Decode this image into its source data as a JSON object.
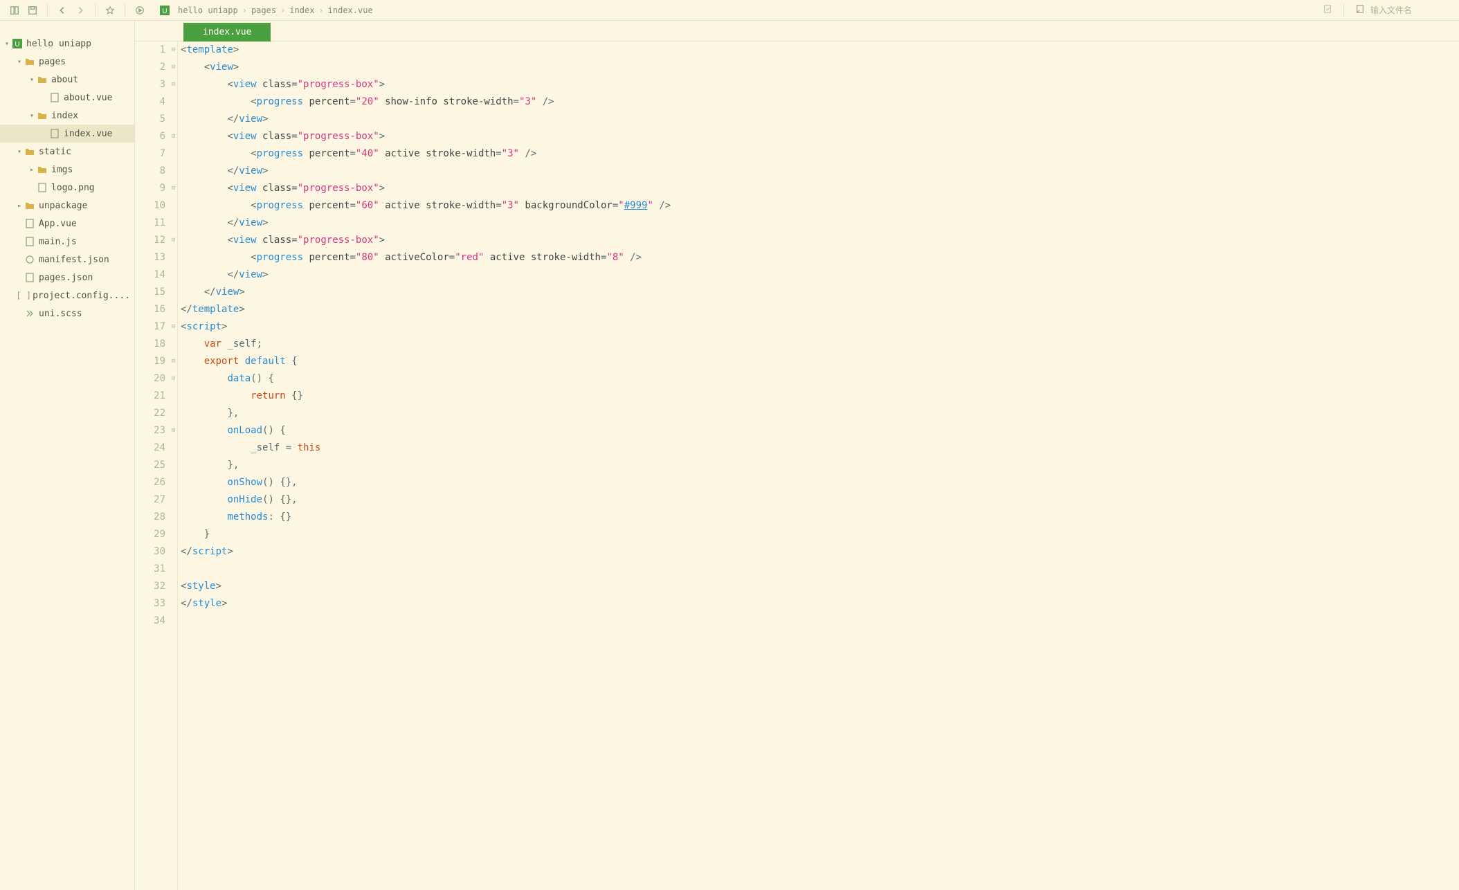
{
  "toolbar": {
    "search_placeholder": "输入文件名"
  },
  "breadcrumb": {
    "parts": [
      "hello uniapp",
      "pages",
      "index",
      "index.vue"
    ]
  },
  "tree": [
    {
      "depth": 0,
      "arrow": "▾",
      "type": "project",
      "label": "hello uniapp"
    },
    {
      "depth": 1,
      "arrow": "▾",
      "type": "folder",
      "label": "pages"
    },
    {
      "depth": 2,
      "arrow": "▾",
      "type": "folder",
      "label": "about"
    },
    {
      "depth": 3,
      "arrow": "",
      "type": "file",
      "label": "about.vue"
    },
    {
      "depth": 2,
      "arrow": "▾",
      "type": "folder",
      "label": "index",
      "selected_folder": false
    },
    {
      "depth": 3,
      "arrow": "",
      "type": "file",
      "label": "index.vue",
      "selected": true
    },
    {
      "depth": 1,
      "arrow": "▾",
      "type": "folder",
      "label": "static"
    },
    {
      "depth": 2,
      "arrow": "▸",
      "type": "folder",
      "label": "imgs"
    },
    {
      "depth": 2,
      "arrow": "",
      "type": "image",
      "label": "logo.png"
    },
    {
      "depth": 1,
      "arrow": "▸",
      "type": "folder",
      "label": "unpackage"
    },
    {
      "depth": 1,
      "arrow": "",
      "type": "file",
      "label": "App.vue"
    },
    {
      "depth": 1,
      "arrow": "",
      "type": "file",
      "label": "main.js"
    },
    {
      "depth": 1,
      "arrow": "",
      "type": "json",
      "label": "manifest.json"
    },
    {
      "depth": 1,
      "arrow": "",
      "type": "file",
      "label": "pages.json"
    },
    {
      "depth": 1,
      "arrow": "",
      "type": "bracket",
      "label": "project.config...."
    },
    {
      "depth": 1,
      "arrow": "",
      "type": "scss",
      "label": "uni.scss"
    }
  ],
  "tabs": {
    "active": "index.vue"
  },
  "editor": {
    "line_count": 34,
    "foldable_lines": [
      1,
      2,
      3,
      6,
      9,
      12,
      17,
      19,
      20,
      23
    ],
    "code": {
      "l1": {
        "tag": "template"
      },
      "l2": {
        "tag": "view"
      },
      "l3": {
        "tag": "view",
        "attr": "class",
        "val": "\"progress-box\""
      },
      "l4": {
        "tag": "progress",
        "a1": "percent",
        "v1": "\"20\"",
        "a2": "show-info",
        "a3": "stroke-width",
        "v3": "\"3\""
      },
      "l5": {
        "tag": "view"
      },
      "l6": {
        "tag": "view",
        "attr": "class",
        "val": "\"progress-box\""
      },
      "l7": {
        "tag": "progress",
        "a1": "percent",
        "v1": "\"40\"",
        "a2": "active",
        "a3": "stroke-width",
        "v3": "\"3\""
      },
      "l8": {
        "tag": "view"
      },
      "l9": {
        "tag": "view",
        "attr": "class",
        "val": "\"progress-box\""
      },
      "l10": {
        "tag": "progress",
        "a1": "percent",
        "v1": "\"60\"",
        "a2": "active",
        "a3": "stroke-width",
        "v3": "\"3\"",
        "a4": "backgroundColor",
        "v4": "\"",
        "v4link": "#999",
        "v4end": "\""
      },
      "l11": {
        "tag": "view"
      },
      "l12": {
        "tag": "view",
        "attr": "class",
        "val": "\"progress-box\""
      },
      "l13": {
        "tag": "progress",
        "a1": "percent",
        "v1": "\"80\"",
        "a2": "activeColor",
        "v2": "\"red\"",
        "a3": "active",
        "a4": "stroke-width",
        "v4": "\"8\""
      },
      "l14": {
        "tag": "view"
      },
      "l15": {
        "tag": "view"
      },
      "l16": {
        "tag": "template"
      },
      "l17": {
        "tag": "script"
      },
      "l18": {
        "kw": "var",
        "ident": "_self",
        "punc": ";"
      },
      "l19": {
        "kw": "export",
        "kw2": "default",
        "punc": "{"
      },
      "l20": {
        "ident": "data",
        "paren": "()",
        "punc": "{"
      },
      "l21": {
        "kw": "return",
        "punc": "{}"
      },
      "l22": {
        "punc": "},"
      },
      "l23": {
        "ident": "onLoad",
        "paren": "()",
        "punc": "{"
      },
      "l24": {
        "ident": "_self",
        "op": "=",
        "kw": "this"
      },
      "l25": {
        "punc": "},"
      },
      "l26": {
        "ident": "onShow",
        "paren": "()",
        "punc": "{},"
      },
      "l27": {
        "ident": "onHide",
        "paren": "()",
        "punc": "{},"
      },
      "l28": {
        "ident": "methods",
        "colon": ":",
        "punc": "{}"
      },
      "l29": {
        "punc": "}"
      },
      "l30": {
        "tag": "script"
      },
      "l31": {
        "blank": true
      },
      "l32": {
        "tag": "style"
      },
      "l33": {
        "tag": "style"
      },
      "l34": {
        "blank": true
      }
    }
  }
}
